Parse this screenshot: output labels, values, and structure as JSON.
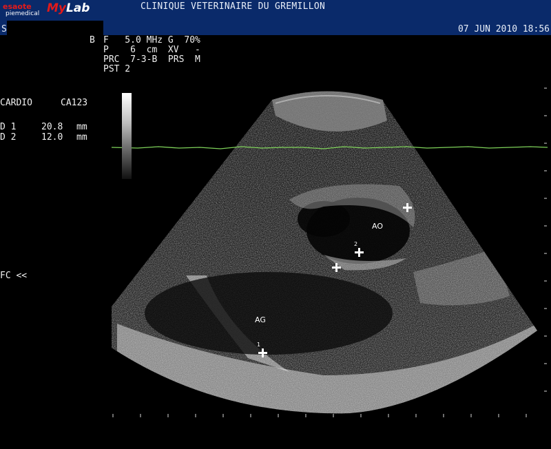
{
  "header": {
    "brand_name": "esaote",
    "brand_sub": "piemedical",
    "product_my": "My",
    "product_lab": "Lab",
    "clinic": "CLINIQUE VETERINAIRE DU GREMILLON",
    "patient_initial": "S",
    "datetime": "07 JUN 2010 18:56",
    "background_color": "#0a2a6a"
  },
  "params": {
    "b_mode": "B",
    "line1": "F   5.0 MHz G  70%",
    "line2": "P    6  cm  XV   -",
    "line3": "PRC  7-3-B  PRS  M",
    "line4": "PST 2"
  },
  "exam": {
    "mode": "CARDIO",
    "probe": "CA123"
  },
  "measurements": [
    {
      "label": "D 1",
      "value": "20.8",
      "unit": "mm"
    },
    {
      "label": "D 2",
      "value": "12.0",
      "unit": "mm"
    }
  ],
  "fc": "FC <<",
  "anatomy_labels": {
    "ao": "AO",
    "ag": "AG"
  },
  "caliper_numbers": {
    "one": "1",
    "two": "2"
  },
  "ecg_color": "#7fd35a",
  "icons": [
    "grayscale-bar",
    "caliper-cross-icon",
    "ecg-trace"
  ]
}
